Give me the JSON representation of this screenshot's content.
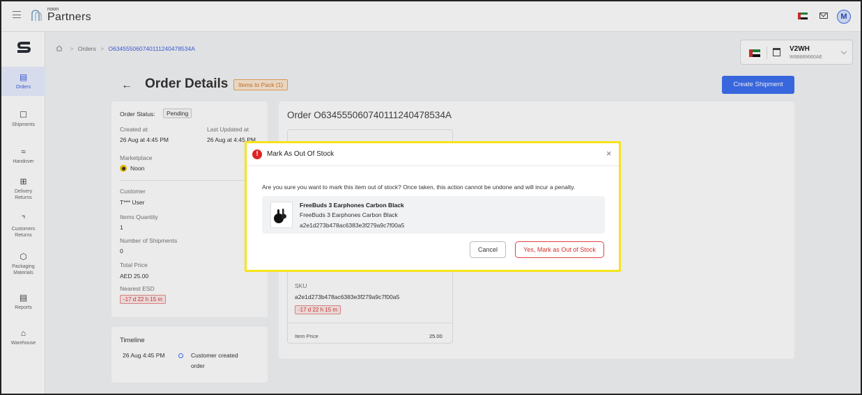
{
  "brand": {
    "small": "noon",
    "big": "Partners"
  },
  "sidebar": {
    "items": [
      {
        "label": "Orders",
        "icon": "orders-icon"
      },
      {
        "label": "Shipments",
        "icon": "truck-icon"
      },
      {
        "label": "Handover",
        "icon": "handshake-icon"
      },
      {
        "label_1": "Delivery",
        "label_2": "Returns",
        "icon": "delivery-returns-icon"
      },
      {
        "label_1": "Customers",
        "label_2": "Returns",
        "icon": "customer-returns-icon"
      },
      {
        "label_1": "Packaging",
        "label_2": "Materials",
        "icon": "box-icon"
      },
      {
        "label": "Reports",
        "icon": "reports-icon"
      },
      {
        "label": "Warehouse",
        "icon": "warehouse-icon"
      }
    ]
  },
  "breadcrumb": {
    "orders": "Orders",
    "current": "O634555060740111240478534A"
  },
  "warehouse": {
    "code": "V2WH",
    "id": "W88889660AE"
  },
  "page": {
    "title": "Order Details",
    "status_pill": "Items to Pack (1)",
    "create_button": "Create Shipment"
  },
  "order_summary": {
    "status_label": "Order Status:",
    "status_value": "Pending",
    "created_label": "Created at",
    "created_value": "26 Aug at 4:45 PM",
    "updated_label": "Last Updated at",
    "updated_value": "26 Aug at 4:45 PM",
    "marketplace_label": "Marketplace",
    "marketplace_value": "Noon",
    "customer_label": "Customer",
    "customer_value": "T*** User",
    "items_qty_label": "Items Quantity",
    "items_qty_value": "1",
    "shipments_label": "Number of Shipments",
    "shipments_value": "0",
    "total_label": "Total Price",
    "total_value": "AED 25.00",
    "esd_label": "Nearest ESD",
    "esd_value": "-17 d 22 h 15 m"
  },
  "timeline": {
    "title": "Timeline",
    "entry_time": "26 Aug 4:45 PM",
    "entry_text_1": "Customer created",
    "entry_text_2": "order"
  },
  "order_detail": {
    "title": "Order O634555060740111240478534A",
    "sku_label": "SKU",
    "sku_value": "a2e1d273b478ac6383e3f279a9c7f00a5",
    "esd_value": "-17 d 22 h 15 m",
    "item_price_label": "Item Price",
    "item_price_value": "25.00"
  },
  "modal": {
    "title": "Mark As Out Of Stock",
    "message": "Are you sure you want to mark this item out of stock? Once taken, this action cannot be undone and will incur a penalty.",
    "product_name": "FreeBuds 3 Earphones Carbon Black",
    "product_subtitle": "FreeBuds 3 Earphones Carbon Black",
    "product_sku": "a2e1d273b478ac6383e3f279a9c7f00a5",
    "cancel_label": "Cancel",
    "confirm_label": "Yes, Mark as Out of Stock"
  },
  "user": {
    "initial": "M"
  },
  "colors": {
    "accent": "#3d6ff0",
    "danger": "#d32f2f",
    "highlight": "#f6e319"
  }
}
